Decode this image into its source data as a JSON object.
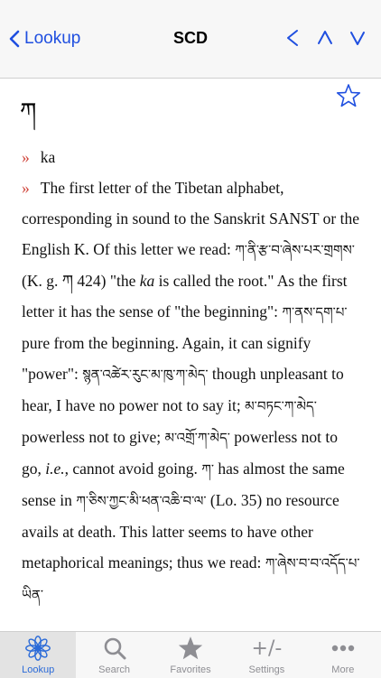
{
  "nav": {
    "back_label": "Lookup",
    "title": "SCD"
  },
  "entry": {
    "headword": "ཀ",
    "bullet": "»",
    "definitions": [
      "ka",
      "The first letter of the Tibetan alphabet, corresponding in sound to the Sanskrit SANST or the English K. Of this letter we read:"
    ],
    "segments": {
      "t1": "ཀ་ནི་རྩ་བ་ཞེས་པར་གྲགས་",
      "s1": " (K. g. ཀ 424) \"the ",
      "s1_italic": "ka",
      "s2": " is called the root.\" As the first letter it has the sense of \"the beginning\": ",
      "t2": "ཀ་ནས་དག་པ་",
      "s3": " pure from the beginning. Again, it can signify \"power\": ",
      "t3": "སྙན་འཚེར་རུང་མ་ཁུ་ཀ་མེད་",
      "s4": " though unpleasant to hear, I have no power not to say it; ",
      "t4": "མ་བཏང་ཀ་མེད་",
      "s5": " powerless not to give; ",
      "t5": "མ་འགྲོ་ཀ་མེད་",
      "s6": " powerless not to go, ",
      "s6_italic": "i.e.",
      "s7": ", cannot avoid going. ",
      "t6": "ཀ་",
      "s8": " has almost the same sense in ",
      "t7": "ཀ་ཅིས་ཀྱང་མི་ཕན་འཆི་བ་ལ་",
      "s9": " (Lo. 35) no resource avails at death. This latter seems to have other metaphorical meanings; thus we read: ",
      "t8": "ཀ་ཞེས་བ་བ་འདོད་པ་ཡིན་"
    }
  },
  "tabs": [
    {
      "label": "Lookup",
      "icon": "lotus-icon"
    },
    {
      "label": "Search",
      "icon": "search-icon"
    },
    {
      "label": "Favorites",
      "icon": "star-icon"
    },
    {
      "label": "Settings",
      "icon": "plus-minus-icon",
      "glyph": "+/-"
    },
    {
      "label": "More",
      "icon": "more-dots-icon"
    }
  ],
  "colors": {
    "accent": "#1f4fe0",
    "bullet": "#d0463c",
    "tab_active": "#2a6ad8",
    "tab_inactive": "#8e8e93"
  }
}
